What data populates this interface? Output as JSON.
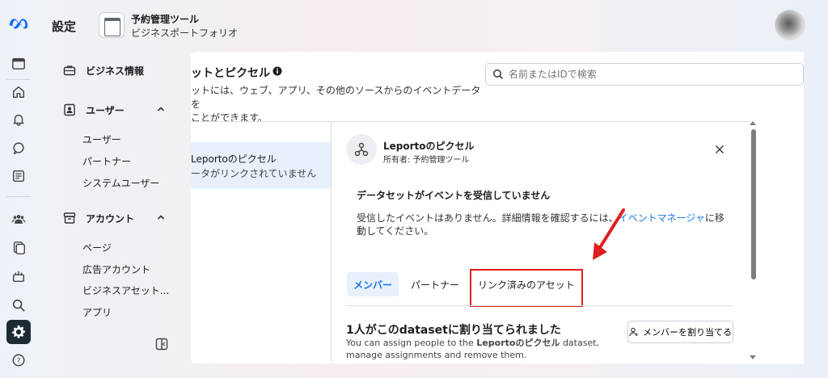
{
  "header": {
    "title": "設定",
    "business_name": "予約管理ツール",
    "business_sub": "ビジネスポートフォリオ"
  },
  "nav": {
    "business_info": "ビジネス情報",
    "users": {
      "label": "ユーザー",
      "items": [
        "ユーザー",
        "パートナー",
        "システムユーザー"
      ]
    },
    "accounts": {
      "label": "アカウント",
      "items": [
        "ページ",
        "広告アカウント",
        "ビジネスアセット...",
        "アプリ"
      ]
    }
  },
  "main": {
    "title": "ットとピクセル",
    "desc_line1": "ットには、ウェブ、アプリ、その他のソースからのイベントデータを",
    "desc_line2": "ことができます。",
    "search_placeholder": "名前またはIDで検索",
    "list_item": {
      "name": "Leportoのピクセル",
      "sub": "ータがリンクされていません"
    }
  },
  "detail": {
    "name": "Leportoのピクセル",
    "owner": "所有者: 予約管理ツール",
    "status_title": "データセットがイベントを受信していません",
    "status_desc_before": "受信したイベントはありません。詳細情報を確認するには、",
    "status_desc_link": "イベントマネージャ",
    "status_desc_after": "に移動してください。",
    "tabs": [
      "メンバー",
      "パートナー",
      "リンク済みのアセット"
    ],
    "assign_title": "1人がこのdatasetに割り当てられました",
    "assign_desc_before": "You can assign people to the ",
    "assign_desc_bold": "Leportoのピクセル",
    "assign_desc_after": " dataset, manage assignments and remove them.",
    "assign_button": "メンバーを割り当てる"
  },
  "colors": {
    "accent": "#1877f2",
    "highlight": "#e02020",
    "active_rail": "#1c2b33"
  }
}
